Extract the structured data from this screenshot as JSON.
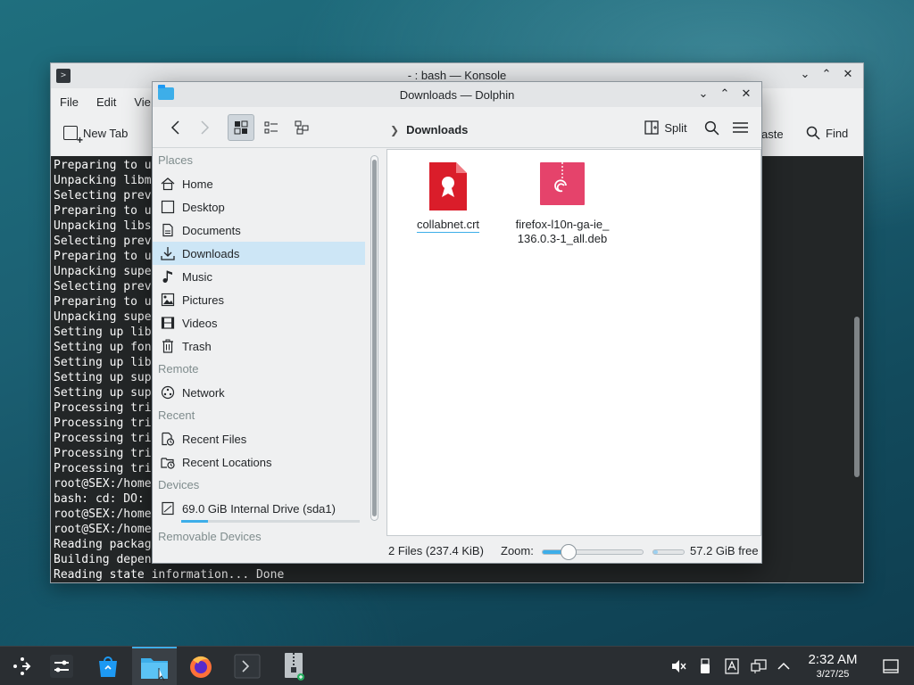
{
  "konsole": {
    "title": "- : bash — Konsole",
    "menu": [
      "File",
      "Edit",
      "Vie"
    ],
    "new_tab_label": "New Tab",
    "paste_label": "aste",
    "find_label": "Find",
    "terminal_lines": [
      "Preparing to u",
      "Unpacking libm",
      "Selecting prev",
      "Preparing to u",
      "Unpacking libs",
      "Selecting prev",
      "Preparing to u",
      "Unpacking supe",
      "Selecting prev",
      "Preparing to u",
      "Unpacking supe",
      "Setting up lib",
      "Setting up fon",
      "Setting up lib",
      "Setting up sup",
      "Setting up sup",
      "Processing tri",
      "Processing tri",
      "Processing tri",
      "Processing tri",
      "Processing tri",
      "root@SEX:/home",
      "bash: cd: DO:",
      "root@SEX:/home",
      "root@SEX:/home",
      "Reading packag",
      "Building depen",
      "Reading state information... Done"
    ]
  },
  "dolphin": {
    "title": "Downloads — Dolphin",
    "breadcrumb": "Downloads",
    "split_label": "Split",
    "sidebar": {
      "sections": [
        {
          "title": "Places",
          "items": [
            {
              "label": "Home",
              "icon": "home-icon"
            },
            {
              "label": "Desktop",
              "icon": "desktop-icon"
            },
            {
              "label": "Documents",
              "icon": "documents-icon"
            },
            {
              "label": "Downloads",
              "icon": "downloads-icon",
              "selected": true
            },
            {
              "label": "Music",
              "icon": "music-icon"
            },
            {
              "label": "Pictures",
              "icon": "pictures-icon"
            },
            {
              "label": "Videos",
              "icon": "videos-icon"
            },
            {
              "label": "Trash",
              "icon": "trash-icon"
            }
          ]
        },
        {
          "title": "Remote",
          "items": [
            {
              "label": "Network",
              "icon": "network-icon"
            }
          ]
        },
        {
          "title": "Recent",
          "items": [
            {
              "label": "Recent Files",
              "icon": "recent-files-icon"
            },
            {
              "label": "Recent Locations",
              "icon": "recent-locations-icon"
            }
          ]
        },
        {
          "title": "Devices",
          "items": [
            {
              "label": "69.0 GiB Internal Drive (sda1)",
              "icon": "drive-icon",
              "usage": 0.15
            }
          ]
        },
        {
          "title": "Removable Devices",
          "items": []
        }
      ]
    },
    "files": [
      {
        "name": "collabnet.crt",
        "icon": "certificate-file-icon",
        "color": "#da1d2a"
      },
      {
        "name_line1": "firefox-l10n-ga-ie_",
        "name_line2": "136.0.3-1_all.deb",
        "icon": "debian-package-icon",
        "color": "#e5436b"
      }
    ],
    "status": {
      "file_count": "2 Files (237.4 KiB)",
      "zoom_label": "Zoom:",
      "zoom_level": 0.25,
      "free_space": "57.2 GiB free",
      "used_fraction": 0.15
    }
  },
  "taskbar": {
    "items": [
      "app-launcher-icon",
      "system-settings-icon",
      "discover-store-icon",
      "dolphin-icon",
      "firefox-icon",
      "konsole-icon",
      "archive-icon"
    ],
    "clock_time": "2:32 AM",
    "clock_date": "3/27/25",
    "accent": "#3daee9"
  }
}
